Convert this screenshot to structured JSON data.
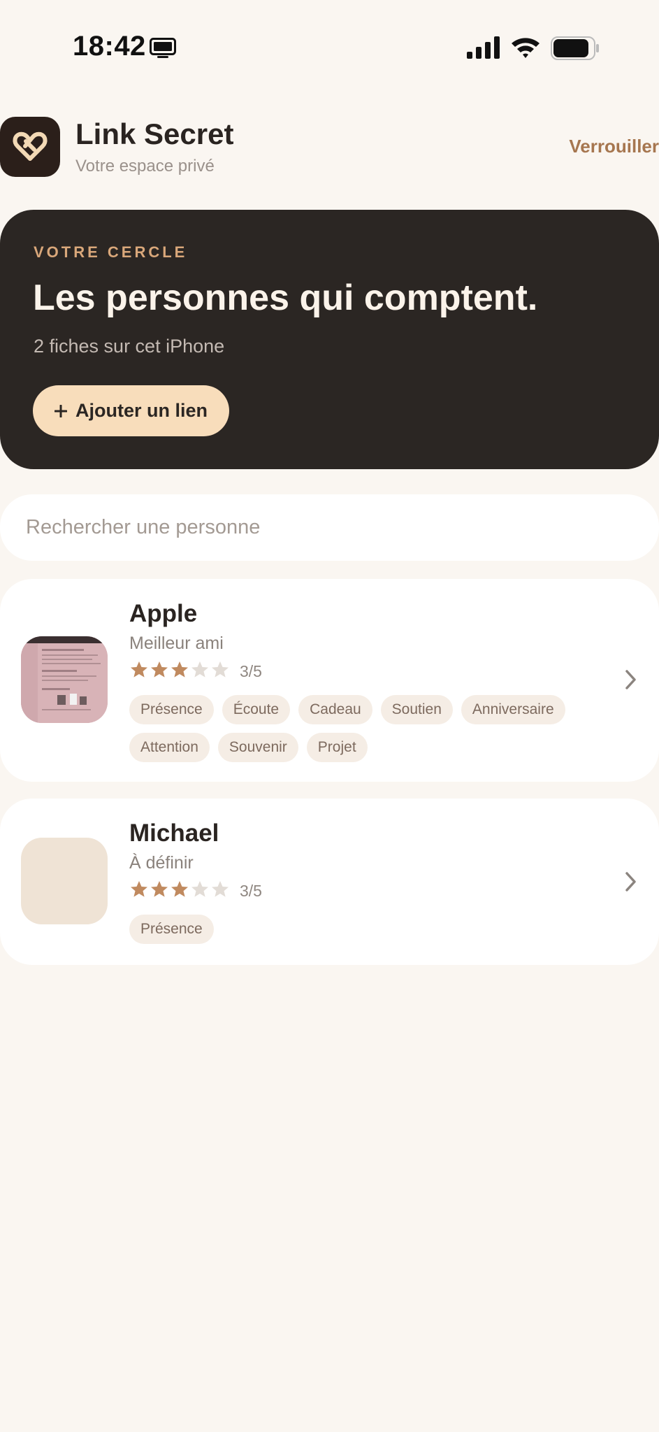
{
  "status_bar": {
    "time": "18:42",
    "icons": [
      "tv-icon",
      "signal-icon",
      "wifi-icon",
      "battery-icon"
    ]
  },
  "header": {
    "logo_icon": "linked-hearts-icon",
    "title": "Link Secret",
    "subtitle": "Votre espace privé",
    "lock_label": "Verrouiller"
  },
  "hero": {
    "eyebrow": "VOTRE CERCLE",
    "title": "Les personnes qui comptent.",
    "count_text": "2 fiches sur cet iPhone",
    "add_icon": "plus",
    "add_label": "Ajouter un lien"
  },
  "search": {
    "placeholder": "Rechercher une personne",
    "value": ""
  },
  "contacts": [
    {
      "name": "Apple",
      "relation": "Meilleur ami",
      "rating": 3,
      "rating_max": 5,
      "rating_text": "3/5",
      "tags": [
        "Présence",
        "Écoute",
        "Cadeau",
        "Soutien",
        "Anniversaire",
        "Attention",
        "Souvenir",
        "Projet"
      ],
      "has_photo": true
    },
    {
      "name": "Michael",
      "relation": "À définir",
      "rating": 3,
      "rating_max": 5,
      "rating_text": "3/5",
      "tags": [
        "Présence"
      ],
      "has_photo": false
    }
  ],
  "colors": {
    "background": "#faf6f1",
    "hero_bg": "#2b2623",
    "accent": "#a6764f",
    "star_filled": "#c08a5f",
    "star_empty": "#e2dcd6",
    "tag_bg": "#f5ede5"
  }
}
